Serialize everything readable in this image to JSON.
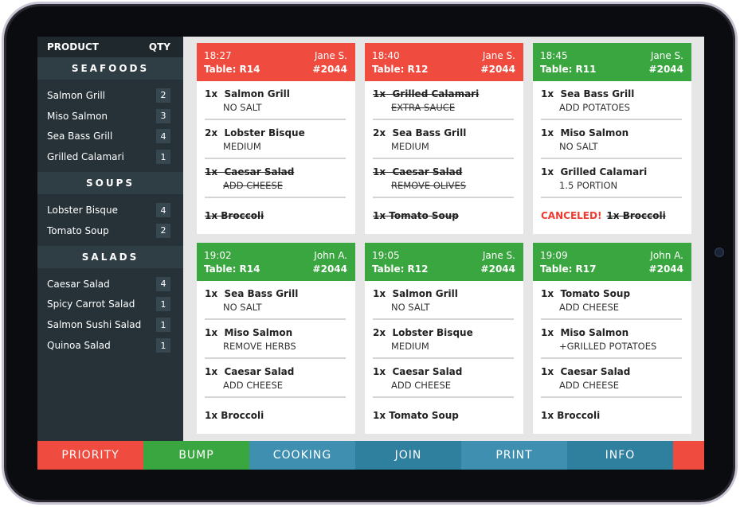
{
  "sidebar": {
    "header": {
      "product": "PRODUCT",
      "qty": "QTY"
    },
    "categories": [
      {
        "name": "SEAFOODS",
        "items": [
          {
            "label": "Salmon Grill",
            "qty": "2"
          },
          {
            "label": "Miso Salmon",
            "qty": "3"
          },
          {
            "label": "Sea Bass Grill",
            "qty": "4"
          },
          {
            "label": "Grilled Calamari",
            "qty": "1"
          }
        ]
      },
      {
        "name": "SOUPS",
        "items": [
          {
            "label": "Lobster Bisque",
            "qty": "4"
          },
          {
            "label": "Tomato Soup",
            "qty": "2"
          }
        ]
      },
      {
        "name": "SALADS",
        "items": [
          {
            "label": "Caesar Salad",
            "qty": "4"
          },
          {
            "label": "Spicy Carrot Salad",
            "qty": "1"
          },
          {
            "label": "Salmon Sushi Salad",
            "qty": "1"
          },
          {
            "label": "Quinoa Salad",
            "qty": "1"
          }
        ]
      }
    ]
  },
  "tickets": [
    {
      "time": "18:27",
      "server": "Jane S.",
      "table": "Table: R14",
      "order": "#2044",
      "status_color": "#ef4b3f",
      "items": [
        {
          "name": "1x  Salmon Grill",
          "mod": "NO SALT",
          "struck": false,
          "canceled": ""
        },
        {
          "name": "2x  Lobster Bisque",
          "mod": "MEDIUM",
          "struck": false,
          "canceled": ""
        },
        {
          "name": "1x  Caesar Salad",
          "mod": "ADD CHEESE",
          "struck": true,
          "canceled": ""
        },
        {
          "name": "1x Broccoli",
          "mod": "",
          "struck": true,
          "canceled": ""
        }
      ]
    },
    {
      "time": "18:40",
      "server": "Jane S.",
      "table": "Table: R12",
      "order": "#2044",
      "status_color": "#ef4b3f",
      "items": [
        {
          "name": "1x  Grilled Calamari",
          "mod": "EXTRA SAUCE",
          "struck": true,
          "canceled": ""
        },
        {
          "name": "2x  Sea Bass Grill",
          "mod": "MEDIUM",
          "struck": false,
          "canceled": ""
        },
        {
          "name": "1x  Caesar Salad",
          "mod": "REMOVE OLIVES",
          "struck": true,
          "canceled": ""
        },
        {
          "name": "1x Tomato Soup",
          "mod": "",
          "struck": true,
          "canceled": ""
        }
      ]
    },
    {
      "time": "18:45",
      "server": "Jane S.",
      "table": "Table: R11",
      "order": "#2044",
      "status_color": "#3aa63f",
      "items": [
        {
          "name": "1x  Sea Bass Grill",
          "mod": "ADD POTATOES",
          "struck": false,
          "canceled": ""
        },
        {
          "name": "1x  Miso Salmon",
          "mod": "NO SALT",
          "struck": false,
          "canceled": ""
        },
        {
          "name": "1x  Grilled Calamari",
          "mod": "1.5 PORTION",
          "struck": false,
          "canceled": ""
        },
        {
          "name": "1x Broccoli",
          "mod": "",
          "struck": true,
          "canceled": "CANCELED!"
        }
      ]
    },
    {
      "time": "19:02",
      "server": "John A.",
      "table": "Table: R14",
      "order": "#2044",
      "status_color": "#3aa63f",
      "items": [
        {
          "name": "1x  Sea Bass Grill",
          "mod": "NO SALT",
          "struck": false,
          "canceled": ""
        },
        {
          "name": "1x  Miso Salmon",
          "mod": "REMOVE HERBS",
          "struck": false,
          "canceled": ""
        },
        {
          "name": "1x  Caesar Salad",
          "mod": "ADD CHEESE",
          "struck": false,
          "canceled": ""
        },
        {
          "name": "1x Broccoli",
          "mod": "",
          "struck": false,
          "canceled": ""
        }
      ]
    },
    {
      "time": "19:05",
      "server": "Jane S.",
      "table": "Table: R12",
      "order": "#2044",
      "status_color": "#3aa63f",
      "items": [
        {
          "name": "1x  Salmon Grill",
          "mod": "NO SALT",
          "struck": false,
          "canceled": ""
        },
        {
          "name": "2x  Lobster Bisque",
          "mod": "MEDIUM",
          "struck": false,
          "canceled": ""
        },
        {
          "name": "1x  Caesar Salad",
          "mod": "ADD CHEESE",
          "struck": false,
          "canceled": ""
        },
        {
          "name": "1x Tomato Soup",
          "mod": "",
          "struck": false,
          "canceled": ""
        }
      ]
    },
    {
      "time": "19:09",
      "server": "John A.",
      "table": "Table: R17",
      "order": "#2044",
      "status_color": "#3aa63f",
      "items": [
        {
          "name": "1x  Tomato Soup",
          "mod": "ADD CHEESE",
          "struck": false,
          "canceled": ""
        },
        {
          "name": "1x  Miso Salmon",
          "mod": "+GRILLED POTATOES",
          "struck": false,
          "canceled": ""
        },
        {
          "name": "1x  Caesar Salad",
          "mod": "ADD CHEESE",
          "struck": false,
          "canceled": ""
        },
        {
          "name": "1x Broccoli",
          "mod": "",
          "struck": false,
          "canceled": ""
        }
      ]
    }
  ],
  "toolbar": [
    {
      "label": "PRIORITY",
      "color": "#ef4b3f",
      "name": "priority-button"
    },
    {
      "label": "BUMP",
      "color": "#3aa63f",
      "name": "bump-button"
    },
    {
      "label": "COOKING",
      "color": "#3f8fb0",
      "name": "cooking-button"
    },
    {
      "label": "JOIN",
      "color": "#2f7f9f",
      "name": "join-button"
    },
    {
      "label": "PRINT",
      "color": "#3f8fb0",
      "name": "print-button"
    },
    {
      "label": "INFO",
      "color": "#2f7f9f",
      "name": "info-button"
    }
  ],
  "toolbar_end_color": "#ef4b3f"
}
